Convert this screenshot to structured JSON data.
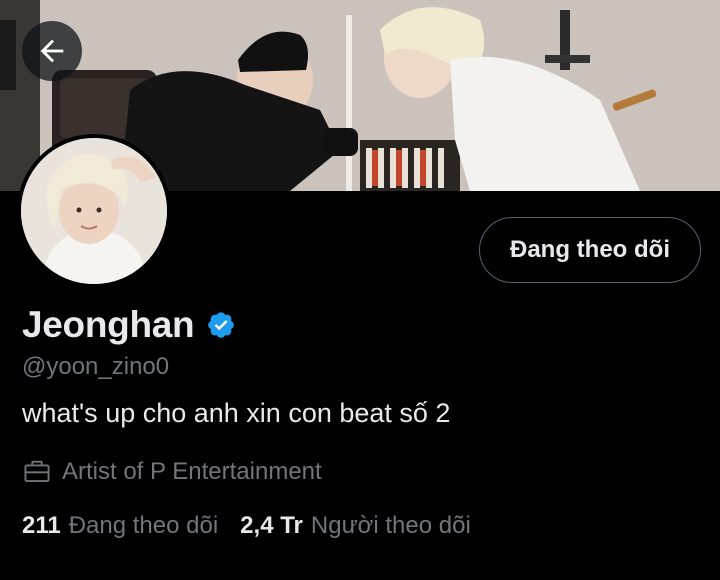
{
  "header": {
    "back_icon": "arrow-left-icon"
  },
  "profile": {
    "display_name": "Jeonghan",
    "verified_icon": "verified-badge-icon",
    "verified_color": "#1d9bf0",
    "handle": "@yoon_zino0",
    "bio": "what's up cho anh xin con beat số 2",
    "category_icon": "briefcase-icon",
    "category": "Artist of P Entertainment"
  },
  "actions": {
    "follow_label": "Đang theo dõi"
  },
  "stats": {
    "following_count": "211",
    "following_label": "Đang theo dõi",
    "followers_count": "2,4 Tr",
    "followers_label": "Người theo dõi"
  },
  "colors": {
    "background": "#000000",
    "primary_text": "#e7e9ea",
    "secondary_text": "#71767b",
    "border": "#536471"
  }
}
